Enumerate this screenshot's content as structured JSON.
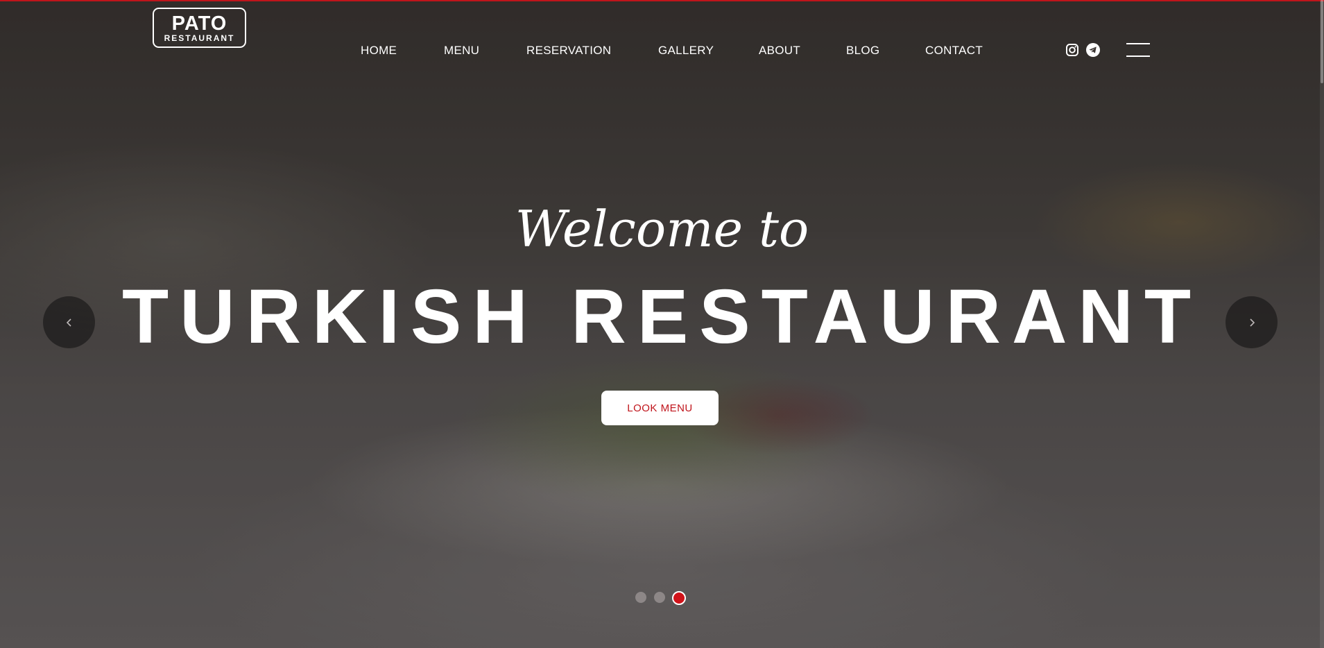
{
  "brand": {
    "line1": "PATO",
    "line2": "RESTAURANT"
  },
  "nav": {
    "items": [
      {
        "label": "HOME"
      },
      {
        "label": "MENU"
      },
      {
        "label": "RESERVATION"
      },
      {
        "label": "GALLERY"
      },
      {
        "label": "ABOUT"
      },
      {
        "label": "BLOG"
      },
      {
        "label": "CONTACT"
      }
    ]
  },
  "social": {
    "icons": [
      "instagram-icon",
      "telegram-icon"
    ]
  },
  "menu_toggle": {
    "icon": "hamburger-menu-icon"
  },
  "hero": {
    "welcome": "Welcome to",
    "headline": "TURKISH RESTAURANT",
    "cta_label": "LOOK MENU",
    "slide_count": 3,
    "active_slide": 3
  },
  "colors": {
    "accent": "#c0141b",
    "text": "#ffffff"
  }
}
